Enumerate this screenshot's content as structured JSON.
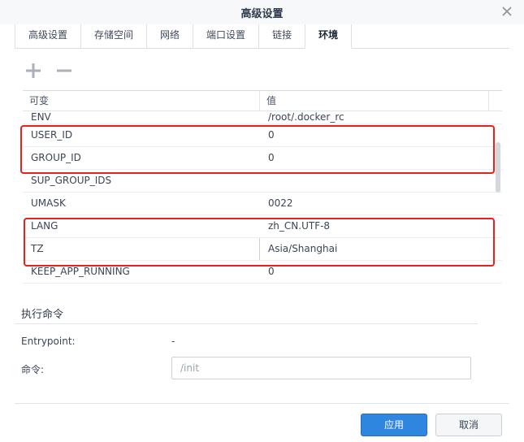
{
  "window": {
    "title": "高级设置"
  },
  "tabs": [
    {
      "label": "高级设置",
      "active": false
    },
    {
      "label": "存储空间",
      "active": false
    },
    {
      "label": "网络",
      "active": false
    },
    {
      "label": "端口设置",
      "active": false
    },
    {
      "label": "链接",
      "active": false
    },
    {
      "label": "环境",
      "active": true
    }
  ],
  "toolbar": {
    "add_icon": "plus-icon",
    "remove_icon": "minus-icon"
  },
  "env_table": {
    "columns": [
      "可变",
      "值"
    ],
    "rows": [
      {
        "key": "ENV",
        "value": "/root/.docker_rc"
      },
      {
        "key": "USER_ID",
        "value": "0"
      },
      {
        "key": "GROUP_ID",
        "value": "0"
      },
      {
        "key": "SUP_GROUP_IDS",
        "value": ""
      },
      {
        "key": "UMASK",
        "value": "0022"
      },
      {
        "key": "LANG",
        "value": "zh_CN.UTF-8"
      },
      {
        "key": "TZ",
        "value": "Asia/Shanghai"
      },
      {
        "key": "KEEP_APP_RUNNING",
        "value": "0"
      }
    ]
  },
  "exec": {
    "section_title": "执行命令",
    "entrypoint_label": "Entrypoint:",
    "entrypoint_value": "-",
    "command_label": "命令:",
    "command_placeholder": "/init"
  },
  "footer": {
    "apply_label": "应用",
    "cancel_label": "取消"
  },
  "colors": {
    "accent": "#2e86de",
    "highlight": "#e8211b"
  }
}
